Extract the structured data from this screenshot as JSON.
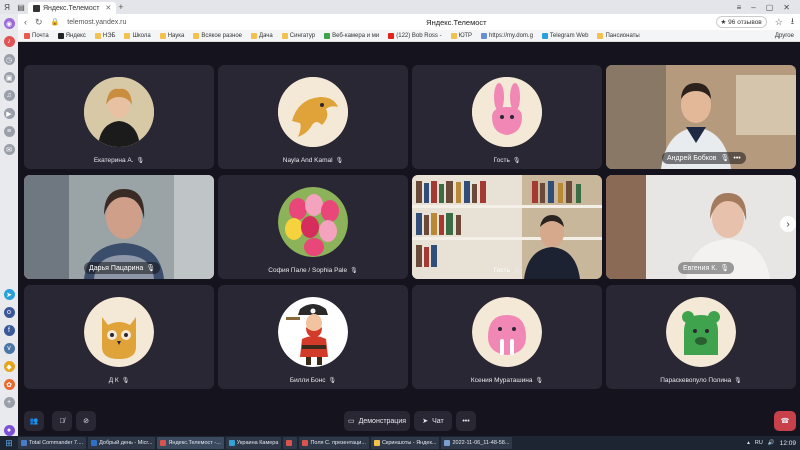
{
  "browser": {
    "tabs": [
      {
        "label": "Яндекс.Телемост"
      }
    ],
    "url": "telemost.yandex.ru",
    "page_title": "Яндекс.Телемост",
    "reviews": "★ 96 отзывов",
    "bookmarks": [
      "Почта",
      "Яндекс",
      "НЭБ",
      "Школа",
      "Наука",
      "Всякое разное",
      "Дача",
      "Сингатур",
      "Веб-камера и ми",
      "(122) Bob Ross -",
      "ЮТР",
      "https://my.dom.g",
      "Telegram Web",
      "Пансионаты"
    ],
    "other_bookmarks": "Другое"
  },
  "participants": [
    {
      "name": "Екатерина А.",
      "kind": "photo",
      "avatar": "woman-portrait"
    },
    {
      "name": "Nayla And Kamal",
      "kind": "avatar",
      "avatar": "dolphin",
      "bg": "#f4e9d6",
      "fg": "#dfa33a"
    },
    {
      "name": "Гость",
      "kind": "avatar",
      "avatar": "rabbit",
      "bg": "#f4e9d6",
      "fg": "#f087b4"
    },
    {
      "name": "Андрей Бобков",
      "kind": "video"
    },
    {
      "name": "Дарья Пацарина",
      "kind": "video",
      "speaking": true
    },
    {
      "name": "София Пале / Sophia Pale",
      "kind": "photo",
      "avatar": "tulips"
    },
    {
      "name": "Гость",
      "kind": "video"
    },
    {
      "name": "Евгения К.",
      "kind": "video"
    },
    {
      "name": "Д К",
      "kind": "avatar",
      "avatar": "owl",
      "bg": "#f4e9d6",
      "fg": "#dfa33a"
    },
    {
      "name": "Билли Бонс",
      "kind": "avatar",
      "avatar": "pirate",
      "bg": "#ffffff",
      "fg": "#d23a2a"
    },
    {
      "name": "Ксения Мураташина",
      "kind": "avatar",
      "avatar": "walrus",
      "bg": "#f4e9d6",
      "fg": "#f087b4"
    },
    {
      "name": "Параскевопуло Полина",
      "kind": "avatar",
      "avatar": "bear",
      "bg": "#f4e9d6",
      "fg": "#3fa34d"
    }
  ],
  "controls": {
    "demo_label": "Демонстрация",
    "chat_label": "Чат",
    "more_label": "•••"
  },
  "taskbar": {
    "items": [
      "Total Commander 7....",
      "Добрый день - Micr...",
      "Яндекс.Телемост -...",
      "Украина Камера",
      "",
      "Поля С. презентаци...",
      "Скриншоты - Яндек...",
      "2022-11-06_11-48-58..."
    ],
    "lang": "RU",
    "time": "12:09"
  }
}
